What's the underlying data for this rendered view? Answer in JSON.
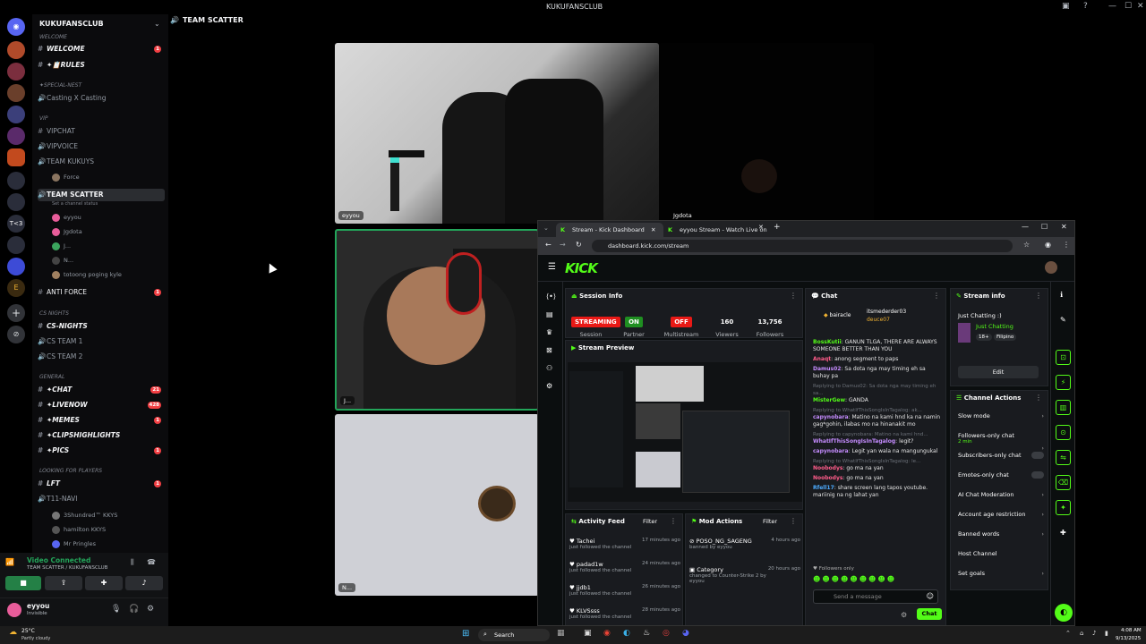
{
  "window": {
    "title": "KUKUFANSCLUB"
  },
  "server": {
    "name": "KUKUFANSCLUB",
    "channels": [
      {
        "label": "WELCOME",
        "prefix": "#",
        "badge": "1",
        "bold": true
      },
      {
        "label": "✦📋RULES",
        "prefix": "#",
        "badge": "",
        "bold": true
      },
      {
        "label": "Casting X Casting",
        "prefix": "🔊",
        "badge": "",
        "bold": false
      },
      {
        "label": "VIPCHAT",
        "prefix": "#",
        "badge": "",
        "bold": false
      },
      {
        "label": "VIPVOICE",
        "prefix": "🔊",
        "badge": "",
        "bold": false
      },
      {
        "label": "TEAM KUKUYS",
        "prefix": "🔊",
        "badge": "",
        "bold": false
      },
      {
        "label": "ANTI FORCE",
        "prefix": "#",
        "badge": "1",
        "bold": false
      },
      {
        "label": "CS-NIGHTS",
        "prefix": "#",
        "badge": "",
        "bold": true
      },
      {
        "label": "CS TEAM 1",
        "prefix": "🔊",
        "badge": "",
        "bold": false
      },
      {
        "label": "CS TEAM 2",
        "prefix": "🔊",
        "badge": "",
        "bold": false
      },
      {
        "label": "✦CHAT",
        "prefix": "#",
        "badge": "21",
        "bold": true
      },
      {
        "label": "✦LIVENOW",
        "prefix": "#",
        "badge": "428",
        "bold": true
      },
      {
        "label": "✦MEMES",
        "prefix": "#",
        "badge": "1",
        "bold": true
      },
      {
        "label": "✦CLIPSHIGHLIGHTS",
        "prefix": "#",
        "badge": "",
        "bold": true
      },
      {
        "label": "✦PICS",
        "prefix": "#",
        "badge": "1",
        "bold": true
      },
      {
        "label": "LFT",
        "prefix": "#",
        "badge": "1",
        "bold": true
      },
      {
        "label": "T11-NAVI",
        "prefix": "🔊",
        "badge": "",
        "bold": false
      }
    ],
    "categories": {
      "welcome": "WELCOME",
      "special": "✦Special-Nest",
      "vip": "VIP",
      "cs": "CS NIGHTS",
      "general": "GENERAL",
      "lfp": "LOOKING FOR PLAYERS"
    },
    "active_channel": "TEAM SCATTER",
    "channel_status": "Set a channel status",
    "kukuys_user": "Force",
    "voice_users": [
      "eyyou",
      "Jgdota",
      "J...",
      "N...",
      "totoong poging kyle"
    ],
    "navi_users": [
      "3Shundred™ KKYS",
      "hamilton KKYS",
      "Mr Pringles"
    ]
  },
  "voice_panel": {
    "status": "Video Connected",
    "location": "TEAM SCATTER / KUKUFANSCLUB"
  },
  "user_panel": {
    "name": "eyyou",
    "status": "Invisible"
  },
  "stage": {
    "header": "TEAM SCATTER",
    "tiles": [
      "eyyou",
      "Jgdota",
      "J...",
      "N..."
    ]
  },
  "browser": {
    "tabs": [
      "Stream - Kick Dashboard",
      "eyyou Stream - Watch Live on Kick"
    ],
    "url": "dashboard.kick.com/stream"
  },
  "kick": {
    "logo": "KICK",
    "session": {
      "title": "Session Info",
      "streaming": "STREAMING",
      "session_label": "Session",
      "partner_value": "ON",
      "partner_label": "Partner",
      "multistream_value": "OFF",
      "multistream_label": "Multistream",
      "viewers_value": "160",
      "viewers_label": "Viewers",
      "followers_value": "13,756",
      "followers_label": "Followers"
    },
    "preview_title": "Stream Preview",
    "activity": {
      "title": "Activity Feed",
      "filter": "Filter",
      "items": [
        {
          "user": "Tachei",
          "action": "just followed the channel",
          "time": "17 minutes ago"
        },
        {
          "user": "padad1w",
          "action": "just followed the channel",
          "time": "24 minutes ago"
        },
        {
          "user": "jjdb1",
          "action": "just followed the channel",
          "time": "26 minutes ago"
        },
        {
          "user": "KLVSsss",
          "action": "just followed the channel",
          "time": "28 minutes ago"
        }
      ]
    },
    "mod": {
      "title": "Mod Actions",
      "filter": "Filter",
      "items": [
        {
          "title": "POSO_NG_SAGENG",
          "detail": "banned by eyyou",
          "time": "4 hours ago"
        },
        {
          "title": "Category",
          "detail": "changed to Counter-Strike 2 by eyyou",
          "time": "20 hours ago"
        }
      ]
    },
    "chat": {
      "title": "Chat",
      "top_users": [
        "bairacle",
        "itsmederder03",
        "deuce07"
      ],
      "messages": [
        {
          "user": "BossKutii",
          "text": "GANUN TLGA, THERE ARE ALWAYS SOMEONE BETTER THAN YOU",
          "reply": "",
          "color": "#53fc18"
        },
        {
          "user": "Anaqt",
          "text": "anong segment to paps",
          "reply": "",
          "color": "#ff5c8a"
        },
        {
          "user": "Damus02",
          "text": "Sa dota nga may timing eh sa buhay pa",
          "reply": "",
          "color": "#c58cff"
        },
        {
          "user": "MisterGew",
          "text": "GANDA",
          "reply": "Replying to Damus02: Sa dota nga may timing eh sa...",
          "color": "#53fc18"
        },
        {
          "user": "capynobara",
          "text": "Matino na kami hnd ka na namin gag*gohin, ilabas mo na hinanakit mo",
          "reply": "Replying to WhatIfThisSongIsInTagalog: ak...",
          "color": "#c58cff"
        },
        {
          "user": "WhatIfThisSongIsInTagalog",
          "text": "legit?",
          "reply": "Replying to capynobara: Matino na kami hnd...",
          "color": "#c58cff"
        },
        {
          "user": "capynobara",
          "text": "Legit yan wala na mangungukal",
          "reply": "",
          "color": "#c58cff"
        },
        {
          "user": "Noobodys",
          "text": "go ma na yan",
          "reply": "Replying to WhatIfThisSongIsInTagalog: le...",
          "color": "#ff5c8a"
        },
        {
          "user": "Noobodys",
          "text": "go ma na yan",
          "reply": "",
          "color": "#ff5c8a"
        },
        {
          "user": "Rfell17",
          "text": "share screen lang tapos youtube. mariinig na ng lahat yan",
          "reply": "",
          "color": "#4dabff"
        }
      ],
      "followers_only": "Followers only",
      "placeholder": "Send a message",
      "send": "Chat"
    },
    "stream_info": {
      "title": "Stream info",
      "stream_title": "Just Chatting :)",
      "category": "Just Chatting",
      "tags": [
        "18+",
        "Filipino"
      ],
      "edit": "Edit"
    },
    "channel_actions": {
      "title": "Channel Actions",
      "items": [
        {
          "label": "Slow mode",
          "sub": "",
          "kind": "arrow"
        },
        {
          "label": "Followers-only chat",
          "sub": "2 min",
          "kind": "arrow"
        },
        {
          "label": "Subscribers-only chat",
          "sub": "",
          "kind": "toggle"
        },
        {
          "label": "Emotes-only chat",
          "sub": "",
          "kind": "toggle"
        },
        {
          "label": "AI Chat Moderation",
          "sub": "",
          "kind": "arrow"
        },
        {
          "label": "Account age restriction",
          "sub": "",
          "kind": "arrow"
        },
        {
          "label": "Banned words",
          "sub": "",
          "kind": "arrow"
        },
        {
          "label": "Host Channel",
          "sub": "",
          "kind": ""
        },
        {
          "label": "Set goals",
          "sub": "",
          "kind": "arrow"
        }
      ]
    }
  },
  "taskbar": {
    "weather_temp": "25°C",
    "weather_desc": "Partly cloudy",
    "search": "Search",
    "time": "4:08 AM",
    "date": "9/13/2025"
  }
}
